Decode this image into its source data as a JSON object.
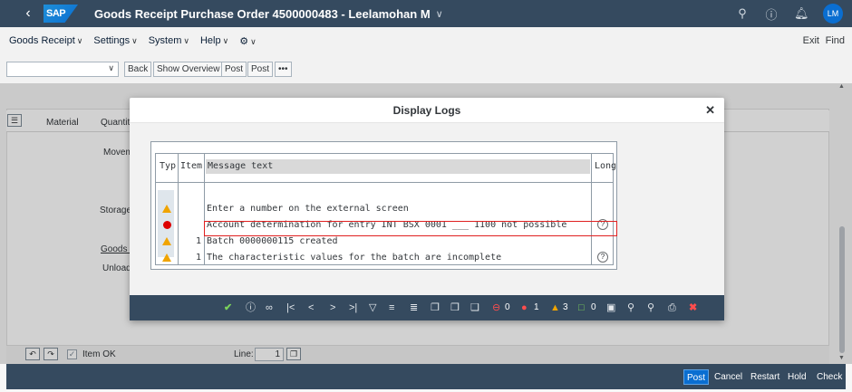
{
  "shell": {
    "logo": "SAP",
    "title": "Goods Receipt Purchase Order 4500000483 - Leelamohan M",
    "avatar": "LM"
  },
  "menubar": {
    "items": [
      "Goods Receipt",
      "Settings",
      "System",
      "Help"
    ],
    "exit": "Exit",
    "find": "Find"
  },
  "toolbar": {
    "select_value": "",
    "buttons": [
      "Back",
      "Show Overview",
      "Post",
      "Post",
      "•••"
    ]
  },
  "background": {
    "col_material": "Material",
    "col_quantity": "Quantity",
    "label_movement": "Movem",
    "label_storage": "Storage",
    "label_goods": "Goods R",
    "label_unload": "Unload",
    "item_ok": "Item OK",
    "line_label": "Line:",
    "line_value": "1"
  },
  "footer": {
    "post": "Post",
    "cancel": "Cancel",
    "restart": "Restart",
    "hold": "Hold",
    "check": "Check"
  },
  "dialog": {
    "title": "Display Logs",
    "columns": {
      "typ": "Typ",
      "item": "Item",
      "message": "Message text",
      "long": "Long"
    },
    "rows": [
      {
        "type": "warning",
        "item": "",
        "message": "Enter a number on the external screen",
        "long": false
      },
      {
        "type": "error",
        "item": "",
        "message": "Account determination for entry INT BSX 0001 ___ 1100 not possible",
        "long": true
      },
      {
        "type": "warning",
        "item": "1",
        "message": "Batch 0000000115 created",
        "long": false
      },
      {
        "type": "warning",
        "item": "1",
        "message": "The characteristic values for the batch are incomplete",
        "long": true
      }
    ],
    "counts": {
      "stop": "0",
      "error": "1",
      "warning": "3",
      "info": "0"
    }
  }
}
